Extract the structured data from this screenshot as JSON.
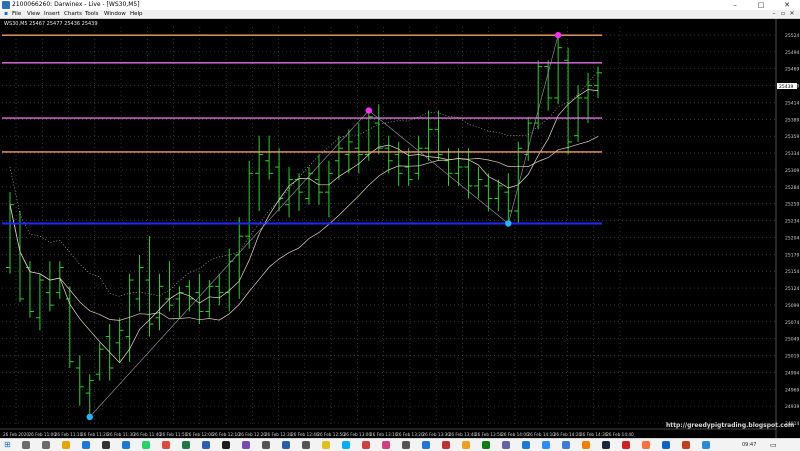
{
  "window": {
    "title": "2100066260: Darwinex - Live - [WS30,M5]",
    "minimize_glyph": "–",
    "maximize_glyph": "□",
    "close_glyph": "✕"
  },
  "menu": {
    "items": [
      "File",
      "View",
      "Insert",
      "Charts",
      "Tools",
      "Window",
      "Help"
    ],
    "doc_controls": [
      "–",
      "▫",
      "✕"
    ]
  },
  "chart": {
    "symbol_label": "WS30,M5  25467 25477 25436 25439",
    "watermark": "http://greedypigtrading.blogspot.com",
    "current_price": "25439",
    "colors": {
      "background": "#000000",
      "grid": "#555555",
      "candle_bull": "#27d327",
      "candle_bear": "#27d327",
      "level_magenta": "#e472e4",
      "level_orange": "#f0a060",
      "level_blue": "#2028ff",
      "marker_cyan": "#22b6ff",
      "marker_magenta": "#ff2cff"
    }
  },
  "chart_data": {
    "type": "candlestick",
    "symbol": "WS30",
    "timeframe": "M5",
    "ylim": [
      24896,
      25533
    ],
    "y_tick_labels": [
      "25524",
      "25494",
      "25469",
      "25439",
      "25414",
      "25389",
      "25359",
      "25334",
      "25309",
      "25284",
      "25259",
      "25234",
      "25204",
      "25179",
      "25154",
      "25124",
      "25099",
      "25074",
      "25049",
      "25019",
      "24994",
      "24969",
      "24939",
      "24914"
    ],
    "x_tick_labels": [
      "26 Feb 2020",
      "26 Feb 11:00",
      "26 Feb 11:10",
      "26 Feb 11:20",
      "26 Feb 11:30",
      "26 Feb 11:40",
      "26 Feb 11:50",
      "26 Feb 12:00",
      "26 Feb 12:10",
      "26 Feb 12:20",
      "26 Feb 12:30",
      "26 Feb 12:40",
      "26 Feb 12:50",
      "26 Feb 13:00",
      "26 Feb 13:10",
      "26 Feb 13:20",
      "26 Feb 13:30",
      "26 Feb 13:40",
      "26 Feb 13:50",
      "26 Feb 14:00",
      "26 Feb 14:10",
      "26 Feb 14:20",
      "26 Feb 14:30",
      "26 Feb 14:40"
    ],
    "horizontal_levels": [
      {
        "value": 25520,
        "color": "orange"
      },
      {
        "value": 25476,
        "color": "magenta"
      },
      {
        "value": 25388,
        "color": "magenta"
      },
      {
        "value": 25334,
        "color": "orange"
      },
      {
        "value": 25220,
        "color": "blue"
      }
    ],
    "bars": [
      {
        "o": 25150,
        "h": 25270,
        "l": 25140,
        "c": 25250
      },
      {
        "o": 25220,
        "h": 25240,
        "l": 25095,
        "c": 25100
      },
      {
        "o": 25150,
        "h": 25160,
        "l": 25070,
        "c": 25080
      },
      {
        "o": 25070,
        "h": 25140,
        "l": 25050,
        "c": 25130
      },
      {
        "o": 25110,
        "h": 25160,
        "l": 25080,
        "c": 25090
      },
      {
        "o": 25110,
        "h": 25160,
        "l": 25100,
        "c": 25150
      },
      {
        "o": 25100,
        "h": 25120,
        "l": 24990,
        "c": 25000
      },
      {
        "o": 24990,
        "h": 25010,
        "l": 24930,
        "c": 24960
      },
      {
        "o": 24950,
        "h": 24980,
        "l": 24912,
        "c": 24970
      },
      {
        "o": 24980,
        "h": 25030,
        "l": 24970,
        "c": 25020
      },
      {
        "o": 25040,
        "h": 25060,
        "l": 24970,
        "c": 24990
      },
      {
        "o": 25030,
        "h": 25070,
        "l": 25000,
        "c": 25050
      },
      {
        "o": 25040,
        "h": 25140,
        "l": 25000,
        "c": 25130
      },
      {
        "o": 25100,
        "h": 25170,
        "l": 25080,
        "c": 25150
      },
      {
        "o": 25130,
        "h": 25200,
        "l": 25040,
        "c": 25060
      },
      {
        "o": 25070,
        "h": 25140,
        "l": 25050,
        "c": 25120
      },
      {
        "o": 25100,
        "h": 25160,
        "l": 25080,
        "c": 25090
      },
      {
        "o": 25100,
        "h": 25120,
        "l": 25070,
        "c": 25110
      },
      {
        "o": 25120,
        "h": 25130,
        "l": 25080,
        "c": 25100
      },
      {
        "o": 25110,
        "h": 25140,
        "l": 25060,
        "c": 25080
      },
      {
        "o": 25080,
        "h": 25130,
        "l": 25070,
        "c": 25120
      },
      {
        "o": 25120,
        "h": 25140,
        "l": 25090,
        "c": 25110
      },
      {
        "o": 25110,
        "h": 25180,
        "l": 25080,
        "c": 25160
      },
      {
        "o": 25170,
        "h": 25230,
        "l": 25100,
        "c": 25200
      },
      {
        "o": 25200,
        "h": 25320,
        "l": 25180,
        "c": 25300
      },
      {
        "o": 25300,
        "h": 25360,
        "l": 25240,
        "c": 25330
      },
      {
        "o": 25320,
        "h": 25360,
        "l": 25290,
        "c": 25300
      },
      {
        "o": 25310,
        "h": 25340,
        "l": 25240,
        "c": 25260
      },
      {
        "o": 25250,
        "h": 25310,
        "l": 25230,
        "c": 25290
      },
      {
        "o": 25290,
        "h": 25300,
        "l": 25240,
        "c": 25270
      },
      {
        "o": 25260,
        "h": 25310,
        "l": 25250,
        "c": 25300
      },
      {
        "o": 25290,
        "h": 25330,
        "l": 25250,
        "c": 25270
      },
      {
        "o": 25270,
        "h": 25320,
        "l": 25230,
        "c": 25300
      },
      {
        "o": 25320,
        "h": 25360,
        "l": 25290,
        "c": 25340
      },
      {
        "o": 25330,
        "h": 25370,
        "l": 25300,
        "c": 25350
      },
      {
        "o": 25340,
        "h": 25380,
        "l": 25300,
        "c": 25330
      },
      {
        "o": 25330,
        "h": 25400,
        "l": 25320,
        "c": 25390
      },
      {
        "o": 25380,
        "h": 25410,
        "l": 25330,
        "c": 25340
      },
      {
        "o": 25340,
        "h": 25360,
        "l": 25300,
        "c": 25320
      },
      {
        "o": 25330,
        "h": 25350,
        "l": 25280,
        "c": 25300
      },
      {
        "o": 25310,
        "h": 25340,
        "l": 25280,
        "c": 25290
      },
      {
        "o": 25300,
        "h": 25360,
        "l": 25290,
        "c": 25340
      },
      {
        "o": 25340,
        "h": 25400,
        "l": 25320,
        "c": 25370
      },
      {
        "o": 25370,
        "h": 25400,
        "l": 25320,
        "c": 25330
      },
      {
        "o": 25320,
        "h": 25340,
        "l": 25280,
        "c": 25300
      },
      {
        "o": 25300,
        "h": 25340,
        "l": 25280,
        "c": 25310
      },
      {
        "o": 25310,
        "h": 25340,
        "l": 25260,
        "c": 25280
      },
      {
        "o": 25280,
        "h": 25310,
        "l": 25260,
        "c": 25290
      },
      {
        "o": 25280,
        "h": 25300,
        "l": 25240,
        "c": 25260
      },
      {
        "o": 25260,
        "h": 25290,
        "l": 25240,
        "c": 25280
      },
      {
        "o": 25270,
        "h": 25300,
        "l": 25220,
        "c": 25240
      },
      {
        "o": 25240,
        "h": 25350,
        "l": 25220,
        "c": 25340
      },
      {
        "o": 25330,
        "h": 25390,
        "l": 25320,
        "c": 25380
      },
      {
        "o": 25380,
        "h": 25480,
        "l": 25370,
        "c": 25470
      },
      {
        "o": 25470,
        "h": 25480,
        "l": 25400,
        "c": 25420
      },
      {
        "o": 25420,
        "h": 25520,
        "l": 25410,
        "c": 25500
      },
      {
        "o": 25480,
        "h": 25500,
        "l": 25330,
        "c": 25350
      },
      {
        "o": 25360,
        "h": 25440,
        "l": 25350,
        "c": 25420
      },
      {
        "o": 25420,
        "h": 25460,
        "l": 25380,
        "c": 25440
      },
      {
        "o": 25440,
        "h": 25470,
        "l": 25420,
        "c": 25460
      }
    ]
  },
  "taskbar": {
    "time": "09:47",
    "icon_names": [
      "search-icon",
      "task-view-icon",
      "explorer-icon",
      "edge-icon",
      "store-icon",
      "mail-icon",
      "whatsapp-icon",
      "chrome-icon",
      "excel-icon",
      "word-icon",
      "terminal-icon",
      "photos-icon",
      "settings-icon",
      "mt4-icon",
      "calc-icon",
      "notes-icon",
      "skype-icon",
      "maps-icon",
      "music-icon",
      "camera-icon",
      "calendar-icon",
      "news-icon",
      "weather-icon",
      "xbox-icon",
      "teams-icon",
      "onedrive-icon",
      "zoom-icon",
      "paint-icon",
      "vlc-icon",
      "steam-icon",
      "acrobat-icon",
      "firefox-icon",
      "outlook-icon",
      "powerpoint-icon",
      "notepad-icon"
    ]
  }
}
